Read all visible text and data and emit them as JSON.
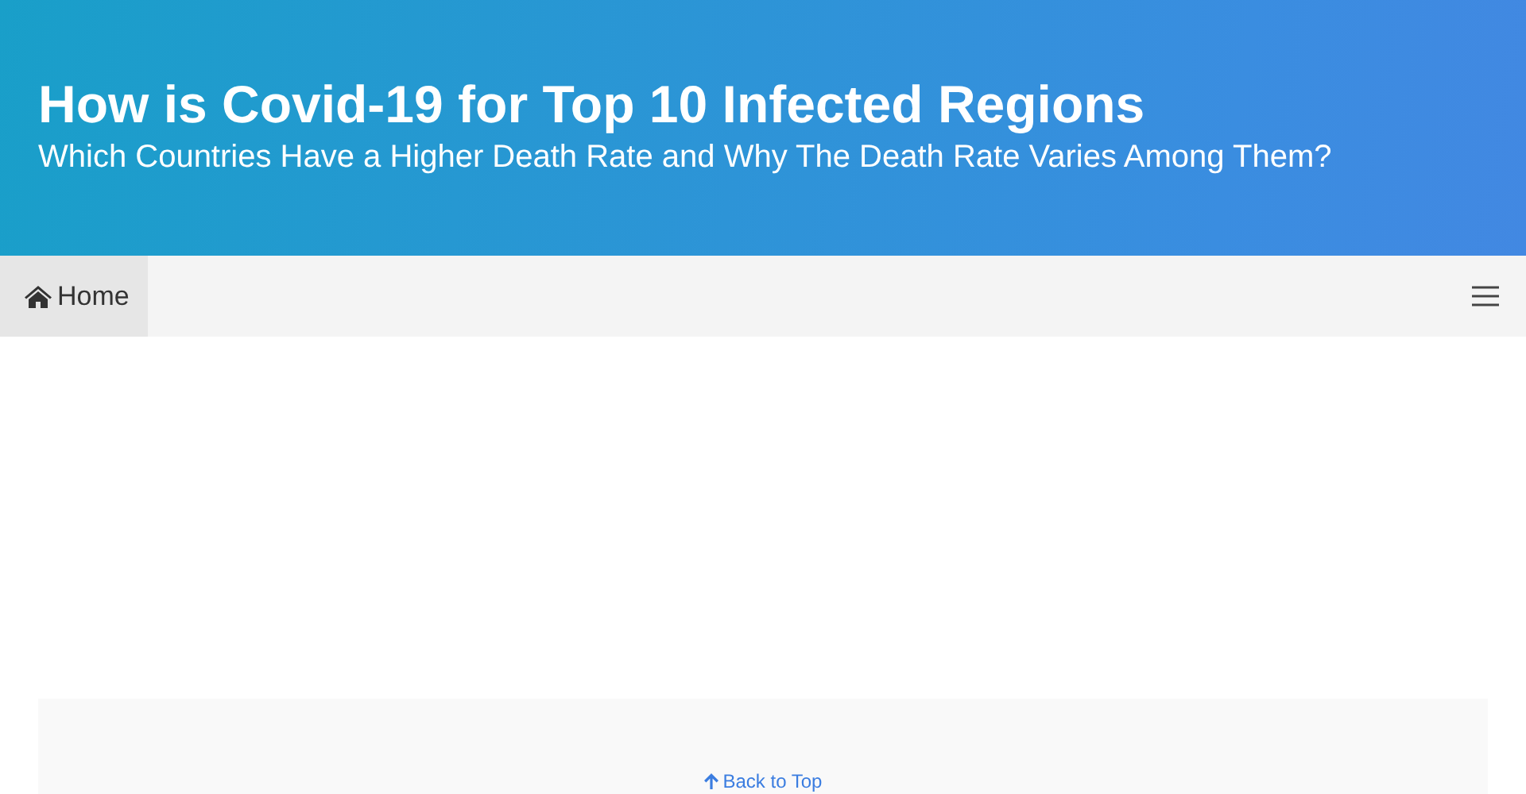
{
  "header": {
    "title": "How is Covid-19 for Top 10 Infected Regions",
    "subtitle": "Which Countries Have a Higher Death Rate and Why The Death Rate Varies Among Them?"
  },
  "nav": {
    "items": [
      {
        "label": "Home",
        "selected": true
      }
    ]
  },
  "footer": {
    "back_to_top": "Back to Top"
  }
}
